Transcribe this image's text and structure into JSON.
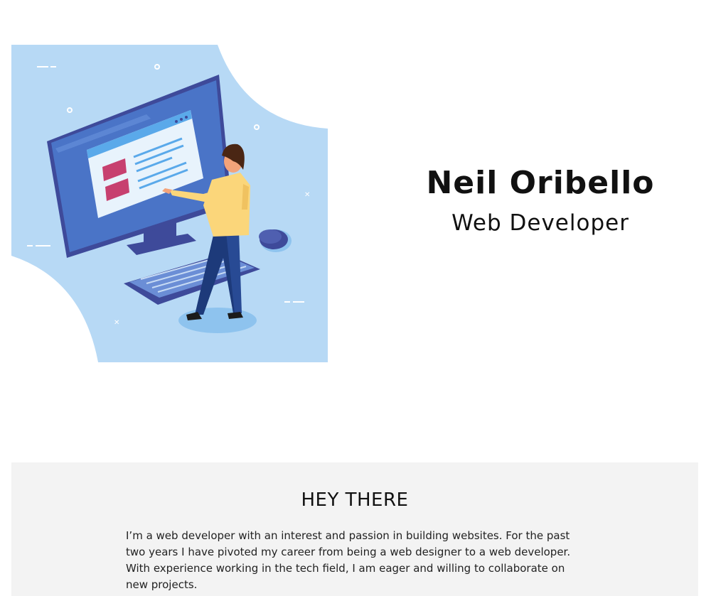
{
  "hero": {
    "name": "Neil Oribello",
    "role": "Web Developer",
    "illustration_icon": "developer-at-computer-illustration"
  },
  "about": {
    "heading": "HEY THERE",
    "body": "I’m a web developer with an interest and passion in building websites. For the past two years I have pivoted my career from being a web designer to a web developer. With experience working in the tech field, I am eager and willing to collaborate on new projects."
  },
  "colors": {
    "background": "#ffffff",
    "illustration_bg": "#b7d9f5",
    "monitor": "#4a74c7",
    "accent_pink": "#c7406f",
    "shirt": "#fbd67a",
    "about_bg": "#f3f3f3"
  }
}
